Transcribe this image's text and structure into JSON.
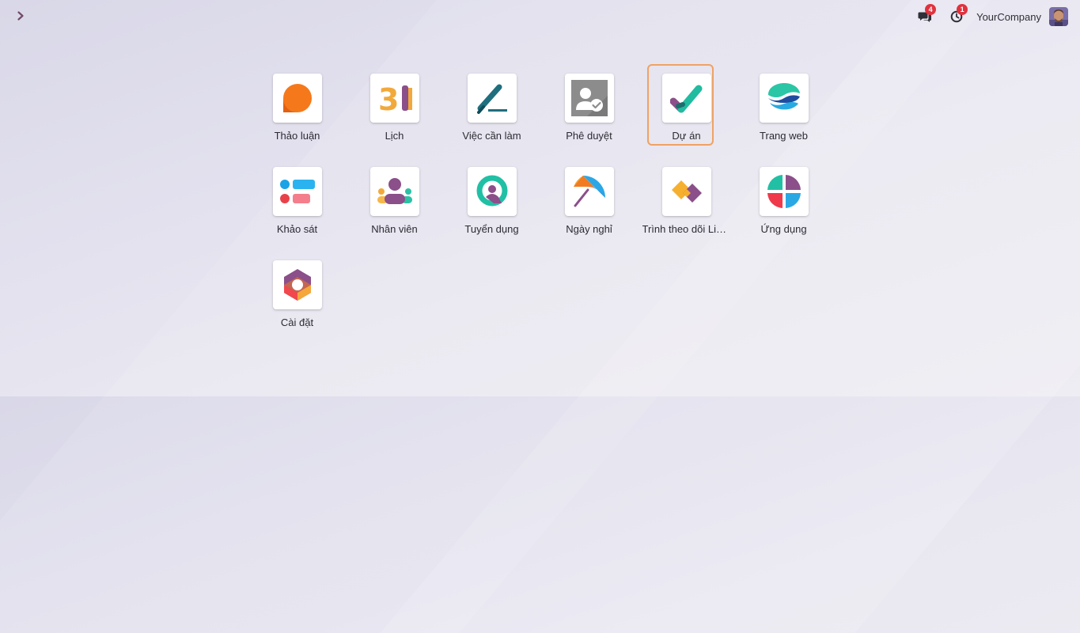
{
  "topbar": {
    "toggle_icon": "chevron-right-icon",
    "messages_badge": "4",
    "activities_badge": "1",
    "company_name": "YourCompany"
  },
  "apps": [
    {
      "label": "Thảo luận",
      "icon": "discuss-icon"
    },
    {
      "label": "Lịch",
      "icon": "calendar-icon",
      "icon_text": "31"
    },
    {
      "label": "Việc cần làm",
      "icon": "todo-icon"
    },
    {
      "label": "Phê duyệt",
      "icon": "approvals-icon"
    },
    {
      "label": "Dự án",
      "icon": "project-icon",
      "focused": true
    },
    {
      "label": "Trang web",
      "icon": "website-icon"
    },
    {
      "label": "Khảo sát",
      "icon": "surveys-icon"
    },
    {
      "label": "Nhân viên",
      "icon": "employees-icon"
    },
    {
      "label": "Tuyển dụng",
      "icon": "recruitment-icon"
    },
    {
      "label": "Ngày nghỉ",
      "icon": "time-off-icon"
    },
    {
      "label": "Trình theo dõi Liê…",
      "icon": "link-tracker-icon"
    },
    {
      "label": "Ứng dụng",
      "icon": "apps-icon"
    },
    {
      "label": "Cài đặt",
      "icon": "settings-icon"
    }
  ],
  "colors": {
    "accent_purple": "#8b4f8a",
    "teal": "#1bb39c",
    "orange": "#f5791b",
    "badge_red": "#e0323e",
    "focus_ring": "#f0a263"
  }
}
